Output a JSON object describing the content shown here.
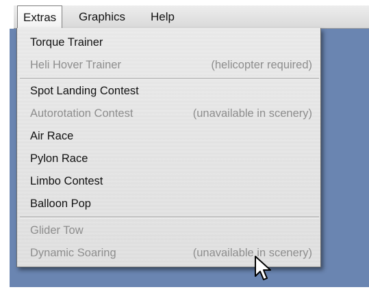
{
  "menubar": {
    "items": [
      {
        "label": "Extras",
        "active": true
      },
      {
        "label": "Graphics",
        "active": false
      },
      {
        "label": "Help",
        "active": false
      }
    ]
  },
  "extras_menu": {
    "items": [
      {
        "label": "Torque Trainer",
        "note": "",
        "enabled": true
      },
      {
        "label": "Heli Hover Trainer",
        "note": "(helicopter required)",
        "enabled": false
      },
      {
        "label": "Spot Landing Contest",
        "note": "",
        "enabled": true
      },
      {
        "label": "Autorotation Contest",
        "note": "(unavailable in scenery)",
        "enabled": false
      },
      {
        "label": "Air Race",
        "note": "",
        "enabled": true
      },
      {
        "label": "Pylon Race",
        "note": "",
        "enabled": true
      },
      {
        "label": "Limbo Contest",
        "note": "",
        "enabled": true
      },
      {
        "label": "Balloon Pop",
        "note": "",
        "enabled": true
      },
      {
        "label": "Glider Tow",
        "note": "",
        "enabled": false
      },
      {
        "label": "Dynamic Soaring",
        "note": "(unavailable in scenery)",
        "enabled": false
      }
    ]
  },
  "colors": {
    "desktop": "#6a85b1",
    "enabled_text": "#111111",
    "disabled_text": "#8d8d8d"
  },
  "cursor": {
    "icon": "arrow-pointer-icon"
  }
}
